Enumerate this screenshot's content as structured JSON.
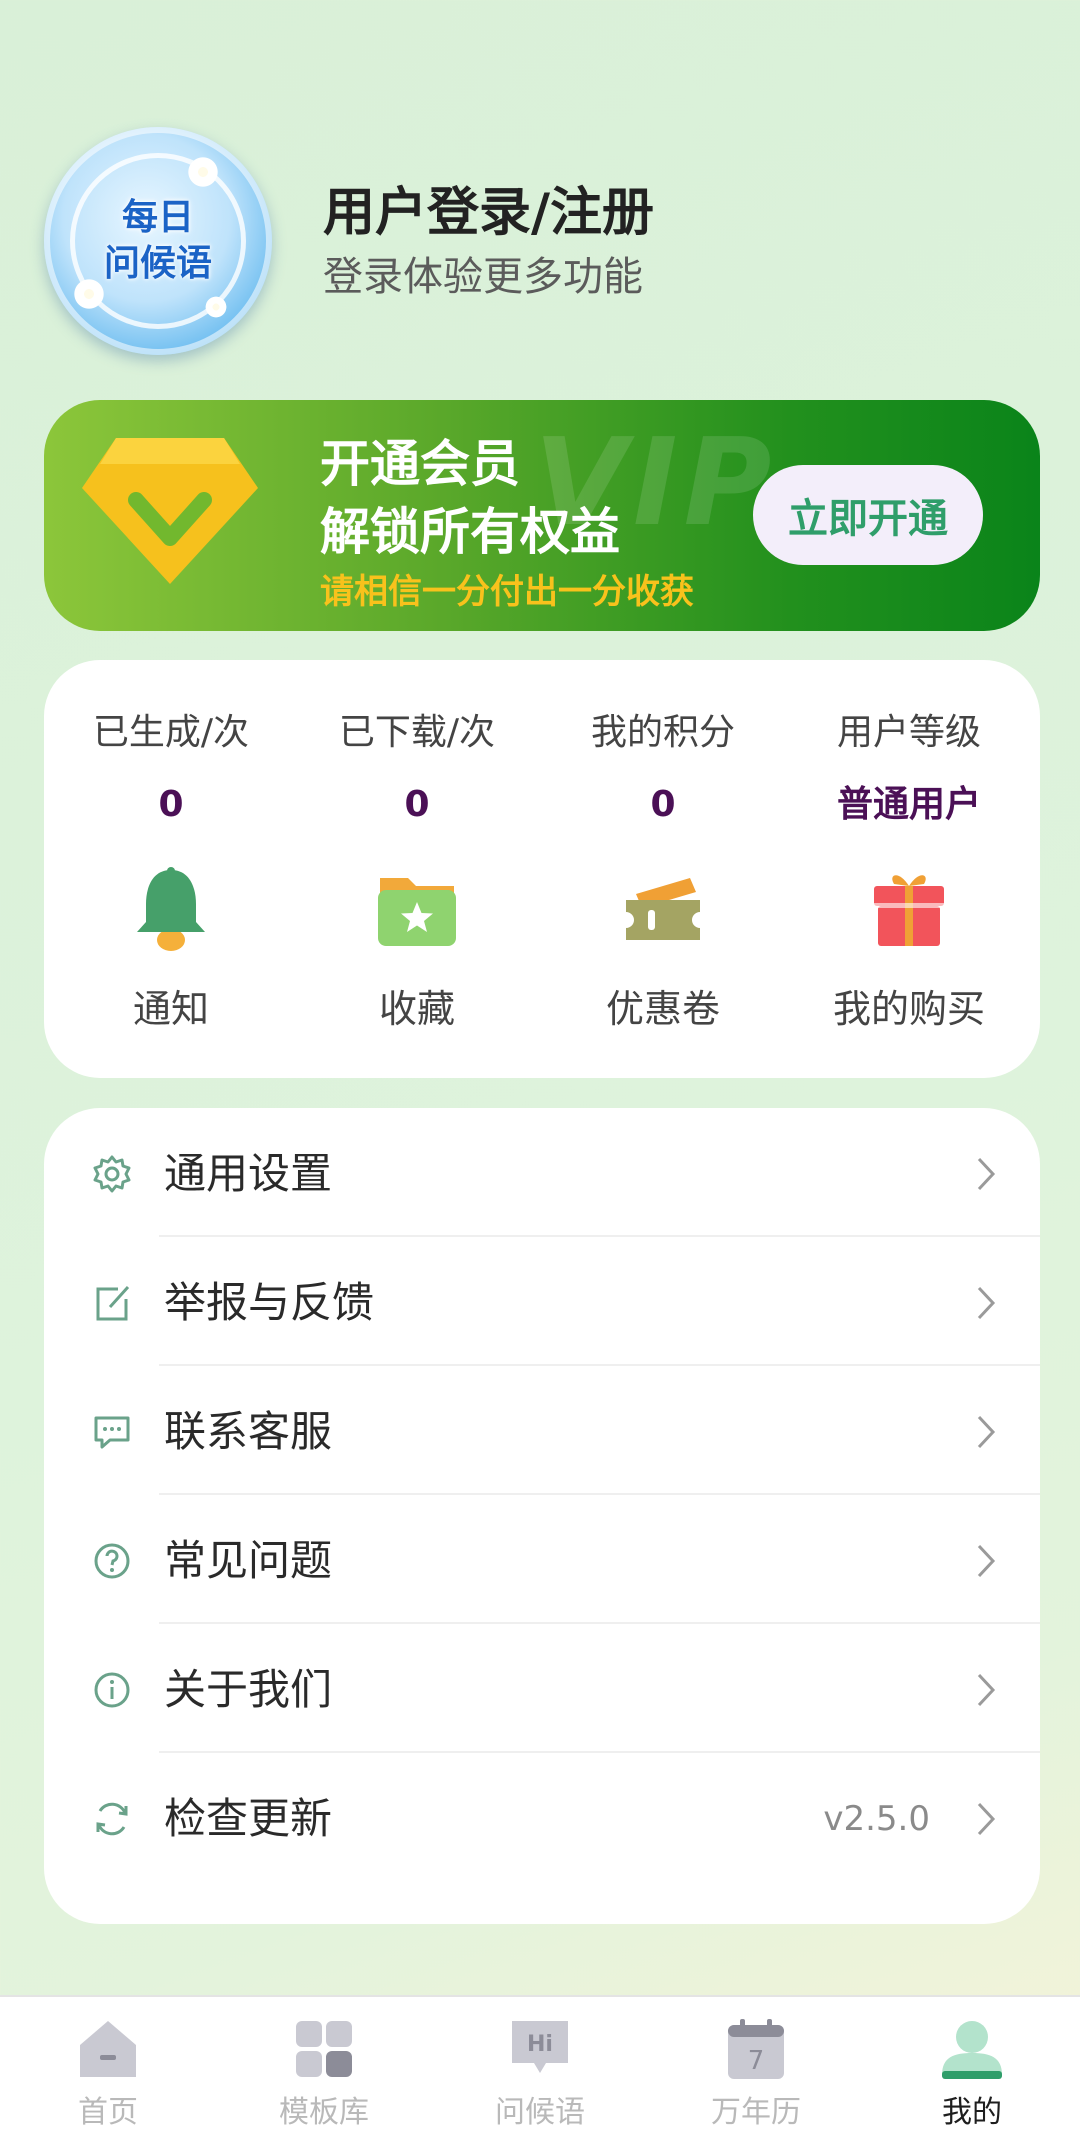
{
  "profile": {
    "avatar_line1": "每日",
    "avatar_line2": "问候语",
    "login_title": "用户登录/注册",
    "login_subtitle": "登录体验更多功能"
  },
  "vip": {
    "watermark": "VIP",
    "title_line1": "开通会员",
    "title_line2": "解锁所有权益",
    "slogan": "请相信一分付出一分收获",
    "button": "立即开通"
  },
  "stats": [
    {
      "label": "已生成/次",
      "value": "0"
    },
    {
      "label": "已下载/次",
      "value": "0"
    },
    {
      "label": "我的积分",
      "value": "0"
    },
    {
      "label": "用户等级",
      "value": "普通用户"
    }
  ],
  "quick_links": [
    {
      "label": "通知",
      "icon": "bell-icon"
    },
    {
      "label": "收藏",
      "icon": "folder-star-icon"
    },
    {
      "label": "优惠卷",
      "icon": "ticket-icon"
    },
    {
      "label": "我的购买",
      "icon": "gift-icon"
    }
  ],
  "settings": [
    {
      "label": "通用设置",
      "icon": "gear-icon"
    },
    {
      "label": "举报与反馈",
      "icon": "edit-icon"
    },
    {
      "label": "联系客服",
      "icon": "chat-icon"
    },
    {
      "label": "常见问题",
      "icon": "question-icon"
    },
    {
      "label": "关于我们",
      "icon": "info-icon"
    },
    {
      "label": "检查更新",
      "icon": "refresh-icon",
      "value": "v2.5.0"
    }
  ],
  "nav": [
    {
      "label": "首页",
      "icon": "home-icon"
    },
    {
      "label": "模板库",
      "icon": "grid-icon"
    },
    {
      "label": "问候语",
      "icon": "hi-bubble-icon"
    },
    {
      "label": "万年历",
      "icon": "calendar-icon",
      "icon_text": "7"
    },
    {
      "label": "我的",
      "icon": "profile-icon",
      "active": true
    }
  ],
  "colors": {
    "accent": "#2f9e6a",
    "value_text": "#4b1056",
    "vip_slogan": "#f8c21c"
  }
}
